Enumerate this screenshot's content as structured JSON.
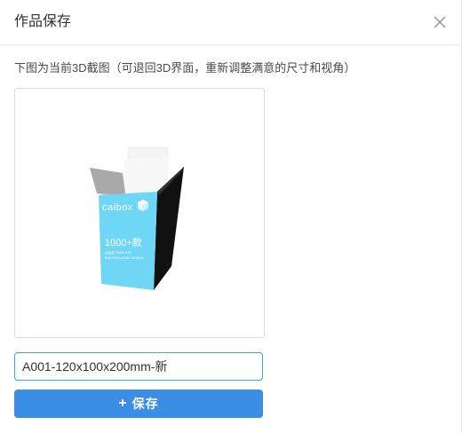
{
  "dialog": {
    "title": "作品保存",
    "close_icon": "close-icon"
  },
  "instructions": "下图为当前3D截图（可退回3D界面，重新调整满意的尺寸和视角）",
  "preview": {
    "box_brand": "caibox",
    "box_headline": "1000+款",
    "box_small_text_1": "包装盒 TEMPLATE",
    "box_small_text_2": "BOX PACKAGING DESIGN",
    "box_colors": {
      "front": "#6fd6f6",
      "side": "#111111",
      "top_flap": "#f2f2f2",
      "back_flap": "#a8a8a8"
    }
  },
  "name_input": {
    "value": "A001-120x100x200mm-新"
  },
  "save_button": {
    "icon": "plus-icon",
    "label": "保存",
    "color": "#3a8ee6"
  }
}
